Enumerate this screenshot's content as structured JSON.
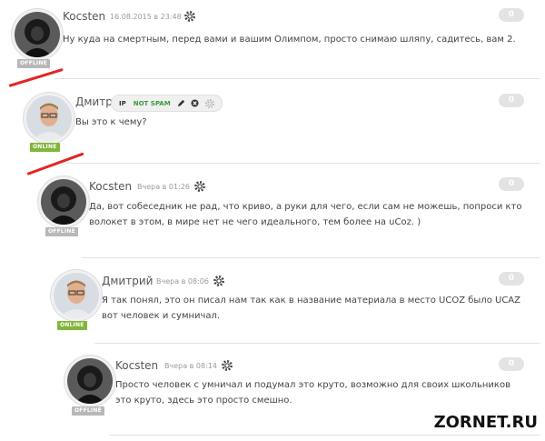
{
  "comments": [
    {
      "author": "Kocsten",
      "date": "16.08.2015 в 23:48",
      "status": "OFFLINE",
      "text": "Ну куда на смертным, перед вами и вашим Олимпом, просто снимаю шляпу, садитесь, вам 2.",
      "votes": "0",
      "avatar": "dark-hood"
    },
    {
      "author": "Дмитри",
      "date": "",
      "status": "ONLINE",
      "text": "Вы это к чему?",
      "votes": "0",
      "avatar": "man-glasses"
    },
    {
      "author": "Kocsten",
      "date": "Вчера в 01:26",
      "status": "OFFLINE",
      "text_lines": [
        "Да, вот собеседник не рад, что криво, а руки для чего, если сам не можешь, попроси кто",
        "волокет в этом, в мире нет не чего идеального, тем более на uCoz. )"
      ],
      "votes": "0",
      "avatar": "dark-hood"
    },
    {
      "author": "Дмитрий",
      "date": "Вчера в 08:06",
      "status": "ONLINE",
      "text_lines": [
        "Я так понял, это он писал нам так как в название материала в место UCOZ было UCAZ",
        "вот человек и сумничал."
      ],
      "votes": "0",
      "avatar": "man-glasses"
    },
    {
      "author": "Kocsten",
      "date": "Вчера в 08:14",
      "status": "OFFLINE",
      "text_lines": [
        "Просто человек с умничал и подумал это круто, возможно для своих школьников",
        "это круто, здесь это просто смешно."
      ],
      "votes": "0",
      "avatar": "dark-hood"
    }
  ],
  "mod_toolbar": {
    "ip_label": "IP",
    "spam_label": "NOT SPAM",
    "icons": [
      "pencil-icon",
      "close-icon",
      "gear-icon"
    ]
  },
  "watermark": "ZORNET.RU",
  "colors": {
    "offline": "#b8b8b8",
    "online": "#82b53b",
    "annotation": "#e52323",
    "votes_bg": "#e3e3e3"
  }
}
